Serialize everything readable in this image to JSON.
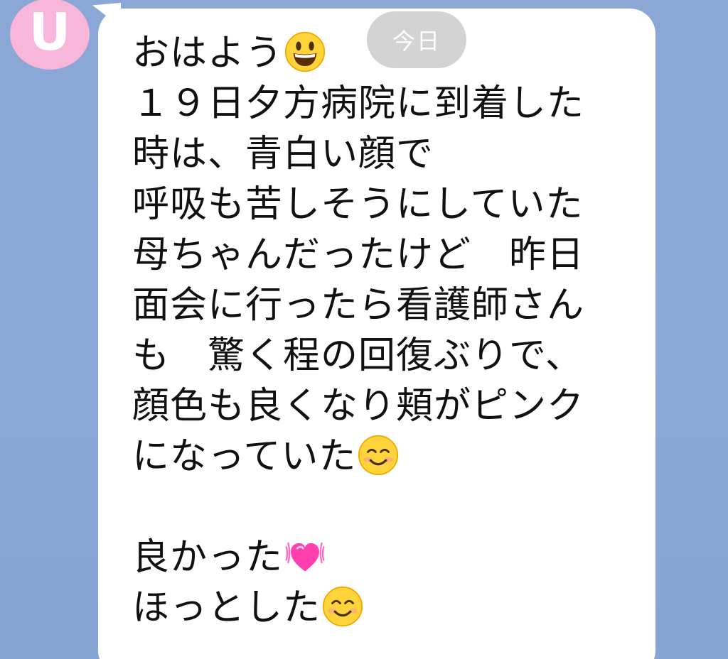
{
  "avatar": {
    "letter": "U"
  },
  "date_label": "今日",
  "message": {
    "lines": [
      {
        "text": "おはよう",
        "emoji": "grinning-face"
      },
      {
        "text": "１９日夕方病院に到着した"
      },
      {
        "text": "時は、青白い顔で"
      },
      {
        "text": "呼吸も苦しそうにしていた"
      },
      {
        "text": "母ちゃんだったけど　昨日"
      },
      {
        "text": "面会に行ったら看護師さん"
      },
      {
        "text": "も　驚く程の回復ぶりで、"
      },
      {
        "text": "顔色も良くなり頬がピンク"
      },
      {
        "text": "になっていた",
        "emoji": "smiling-face-with-smiling-eyes"
      },
      {
        "text": ""
      },
      {
        "text": "良かった",
        "emoji": "beating-heart"
      },
      {
        "text": "ほっとした",
        "emoji": "smiling-face-with-smiling-eyes"
      }
    ]
  },
  "colors": {
    "background": "#8aa7d6",
    "bubble": "#ffffff",
    "avatar": "#f8b6da",
    "date_pill": "#d3d3d3",
    "text": "#111111"
  }
}
